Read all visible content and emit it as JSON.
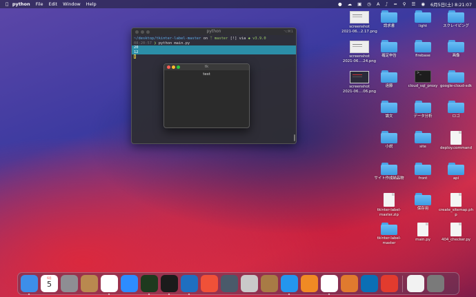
{
  "menubar": {
    "app_name": "python",
    "menus": [
      "File",
      "Edit",
      "Window",
      "Help"
    ],
    "clock": "6月5日(土) 8:21:07"
  },
  "desktop_icons": [
    {
      "label": "screenshot\n2021-06...2.17.png",
      "kind": "screenshot"
    },
    {
      "label": "請求書",
      "kind": "folder"
    },
    {
      "label": "light",
      "kind": "folder"
    },
    {
      "label": "スクレイピング",
      "kind": "folder"
    },
    {
      "label": "screenshot\n2021-06....24.png",
      "kind": "screenshot"
    },
    {
      "label": "確定申告",
      "kind": "folder"
    },
    {
      "label": "firebase",
      "kind": "folder"
    },
    {
      "label": "画像",
      "kind": "folder"
    },
    {
      "label": "screenshot\n2021-06....06.png",
      "kind": "screenshot-dark"
    },
    {
      "label": "遠藤",
      "kind": "folder"
    },
    {
      "label": "cloud_sql_proxy",
      "kind": "terminal"
    },
    {
      "label": "google-cloud-sdk",
      "kind": "folder"
    },
    {
      "label": "論文",
      "kind": "folder"
    },
    {
      "label": "データ分析",
      "kind": "folder"
    },
    {
      "label": "ロゴ",
      "kind": "folder"
    },
    {
      "label": "小説",
      "kind": "folder"
    },
    {
      "label": "site",
      "kind": "folder"
    },
    {
      "label": "deploy.command",
      "kind": "doc"
    },
    {
      "label": "サイト作成納品物",
      "kind": "folder"
    },
    {
      "label": "front",
      "kind": "folder"
    },
    {
      "label": "api",
      "kind": "folder"
    },
    {
      "label": "tkinter-label-\nmaster.zip",
      "kind": "doc"
    },
    {
      "label": "保存用",
      "kind": "folder"
    },
    {
      "label": "create_sitemap.ph\np",
      "kind": "doc"
    },
    {
      "label": "tkinter-label-\nmaster",
      "kind": "folder"
    },
    {
      "label": "main.py",
      "kind": "doc"
    },
    {
      "label": "404_checker.py",
      "kind": "doc"
    }
  ],
  "terminal": {
    "title": "python",
    "shortcut": "⌥⌘1",
    "prompt_path": "~/desktop/tkinter-label-master",
    "prompt_on": "on",
    "branch": "master",
    "branch_status": "[!]",
    "via": "via",
    "python_version": "v3.9.0",
    "time": "08:20:57",
    "command": "python main.py",
    "output": [
      "20",
      "12"
    ]
  },
  "tk_window": {
    "title": "tk",
    "label_text": "test"
  },
  "dock": {
    "apps": [
      {
        "name": "finder-icon",
        "color": "#3d8ee8",
        "running": true
      },
      {
        "name": "calendar-icon",
        "color": "#ffffff",
        "running": false,
        "text_top": "6月",
        "text": "5"
      },
      {
        "name": "system-preferences-icon",
        "color": "#8e8e93",
        "running": false
      },
      {
        "name": "contacts-icon",
        "color": "#b9894f",
        "running": false
      },
      {
        "name": "chrome-icon",
        "color": "#ffffff",
        "running": true
      },
      {
        "name": "zoom-icon",
        "color": "#2d8cff",
        "running": false
      },
      {
        "name": "activity-monitor-icon",
        "color": "#1e3a1e",
        "running": true
      },
      {
        "name": "terminal-icon",
        "color": "#1b1b1b",
        "running": true
      },
      {
        "name": "vscode-icon",
        "color": "#1f6fc0",
        "running": true
      },
      {
        "name": "swift-playgrounds-icon",
        "color": "#f05138",
        "running": false
      },
      {
        "name": "quicktime-icon",
        "color": "#4a5a6a",
        "running": false
      },
      {
        "name": "sequel-pro-icon",
        "color": "#c9c9c9",
        "running": false
      },
      {
        "name": "archive-utility-icon",
        "color": "#a87b45",
        "running": false
      },
      {
        "name": "docker-icon",
        "color": "#2496ed",
        "running": true
      },
      {
        "name": "sourcetree-icon",
        "color": "#f08a24",
        "running": false
      },
      {
        "name": "python-launcher-icon",
        "color": "#ffffff",
        "running": true
      },
      {
        "name": "preview-icon",
        "color": "#e07a2e",
        "running": false
      },
      {
        "name": "arduino-icon",
        "color": "#0a6fb5",
        "running": false
      },
      {
        "name": "clock-icon",
        "color": "#e23b2e",
        "running": false
      },
      {
        "name": "document-icon",
        "color": "#f2f2f2",
        "running": false
      },
      {
        "name": "trash-icon",
        "color": "#7a7a7a",
        "running": false
      }
    ]
  }
}
